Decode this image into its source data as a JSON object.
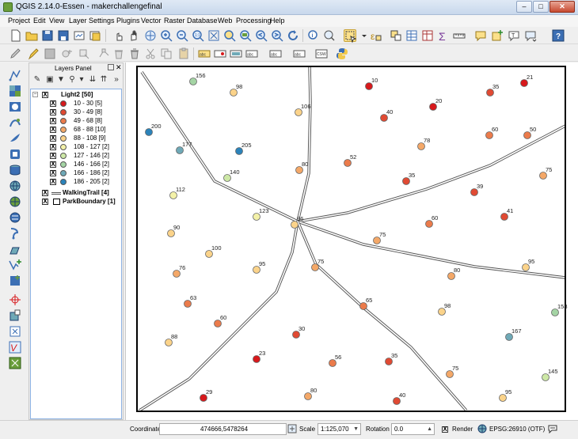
{
  "window": {
    "title": "QGIS 2.14.0-Essen - makerchallengefinal",
    "minimize_label": "–",
    "maximize_label": "□",
    "close_label": "✕"
  },
  "menubar": {
    "items": [
      "Project",
      "Edit",
      "View",
      "Layer",
      "Settings",
      "Plugins",
      "Vector",
      "Raster",
      "Database",
      "Web",
      "Processing",
      "Help"
    ]
  },
  "layers_panel": {
    "title": "Layers Panel",
    "float_label": "",
    "close_label": "✕",
    "root_layer": {
      "name": "Light2 [50]",
      "checked": "X"
    },
    "classes": [
      {
        "label": "10 - 30  [5]",
        "color": "#d7191c"
      },
      {
        "label": "30 - 49  [8]",
        "color": "#e04a33"
      },
      {
        "label": "49 - 68  [8]",
        "color": "#eb7b4b"
      },
      {
        "label": "68 - 88  [10]",
        "color": "#f4a868"
      },
      {
        "label": "88 - 108  [9]",
        "color": "#fbd38a"
      },
      {
        "label": "108 - 127  [2]",
        "color": "#f3f1a8"
      },
      {
        "label": "127 - 146  [2]",
        "color": "#cde8a6"
      },
      {
        "label": "146 - 166  [2]",
        "color": "#a4d4a4"
      },
      {
        "label": "166 - 186  [2]",
        "color": "#6fa9b7"
      },
      {
        "label": "186 - 205  [2]",
        "color": "#2b83ba"
      }
    ],
    "other_layers": [
      {
        "name": "WalkingTrail [4]",
        "checked": "X"
      },
      {
        "name": "ParkBoundary [1]",
        "checked": "X"
      }
    ]
  },
  "statusbar": {
    "coordinate_label": "Coordinate",
    "coordinate_value": "474666,5478264",
    "scale_label": "Scale",
    "scale_value": "1:125,070",
    "rotation_label": "Rotation",
    "rotation_value": "0.0",
    "render_label": "Render",
    "render_checked": "X",
    "crs_label": "EPSG:26910 (OTF)"
  },
  "map": {
    "points": [
      {
        "v": 156,
        "c": "#a4d4a4"
      },
      {
        "v": 98,
        "c": "#fbd38a"
      },
      {
        "v": 10,
        "c": "#d7191c"
      },
      {
        "v": 35,
        "c": "#e04a33"
      },
      {
        "v": 21,
        "c": "#d7191c"
      },
      {
        "v": 106,
        "c": "#fbd38a"
      },
      {
        "v": 20,
        "c": "#d7191c"
      },
      {
        "v": 40,
        "c": "#e04a33"
      },
      {
        "v": 200,
        "c": "#2b83ba"
      },
      {
        "v": 177,
        "c": "#6fa9b7"
      },
      {
        "v": 205,
        "c": "#2b83ba"
      },
      {
        "v": 78,
        "c": "#f4a868"
      },
      {
        "v": 60,
        "c": "#eb7b4b"
      },
      {
        "v": 50,
        "c": "#eb7b4b"
      },
      {
        "v": 52,
        "c": "#eb7b4b"
      },
      {
        "v": 80,
        "c": "#f4a868"
      },
      {
        "v": 140,
        "c": "#cde8a6"
      },
      {
        "v": 75,
        "c": "#f4a868"
      },
      {
        "v": 35,
        "c": "#e04a33"
      },
      {
        "v": 39,
        "c": "#e04a33"
      },
      {
        "v": 112,
        "c": "#f3f1a8"
      },
      {
        "v": 123,
        "c": "#f3f1a8"
      },
      {
        "v": 60,
        "c": "#eb7b4b"
      },
      {
        "v": 41,
        "c": "#e04a33"
      },
      {
        "v": 96,
        "c": "#fbd38a"
      },
      {
        "v": 90,
        "c": "#fbd38a"
      },
      {
        "v": 75,
        "c": "#f4a868"
      },
      {
        "v": 100,
        "c": "#fbd38a"
      },
      {
        "v": 95,
        "c": "#fbd38a"
      },
      {
        "v": 75,
        "c": "#f4a868"
      },
      {
        "v": 95,
        "c": "#fbd38a"
      },
      {
        "v": 76,
        "c": "#f4a868"
      },
      {
        "v": 80,
        "c": "#f4a868"
      },
      {
        "v": 63,
        "c": "#eb7b4b"
      },
      {
        "v": 65,
        "c": "#eb7b4b"
      },
      {
        "v": 98,
        "c": "#fbd38a"
      },
      {
        "v": 158,
        "c": "#a4d4a4"
      },
      {
        "v": 60,
        "c": "#eb7b4b"
      },
      {
        "v": 30,
        "c": "#e04a33"
      },
      {
        "v": 167,
        "c": "#6fa9b7"
      },
      {
        "v": 88,
        "c": "#fbd38a"
      },
      {
        "v": 23,
        "c": "#d7191c"
      },
      {
        "v": 56,
        "c": "#eb7b4b"
      },
      {
        "v": 35,
        "c": "#e04a33"
      },
      {
        "v": 75,
        "c": "#f4a868"
      },
      {
        "v": 145,
        "c": "#cde8a6"
      },
      {
        "v": 29,
        "c": "#d7191c"
      },
      {
        "v": 80,
        "c": "#f4a868"
      },
      {
        "v": 40,
        "c": "#e04a33"
      },
      {
        "v": 95,
        "c": "#fbd38a"
      }
    ]
  }
}
